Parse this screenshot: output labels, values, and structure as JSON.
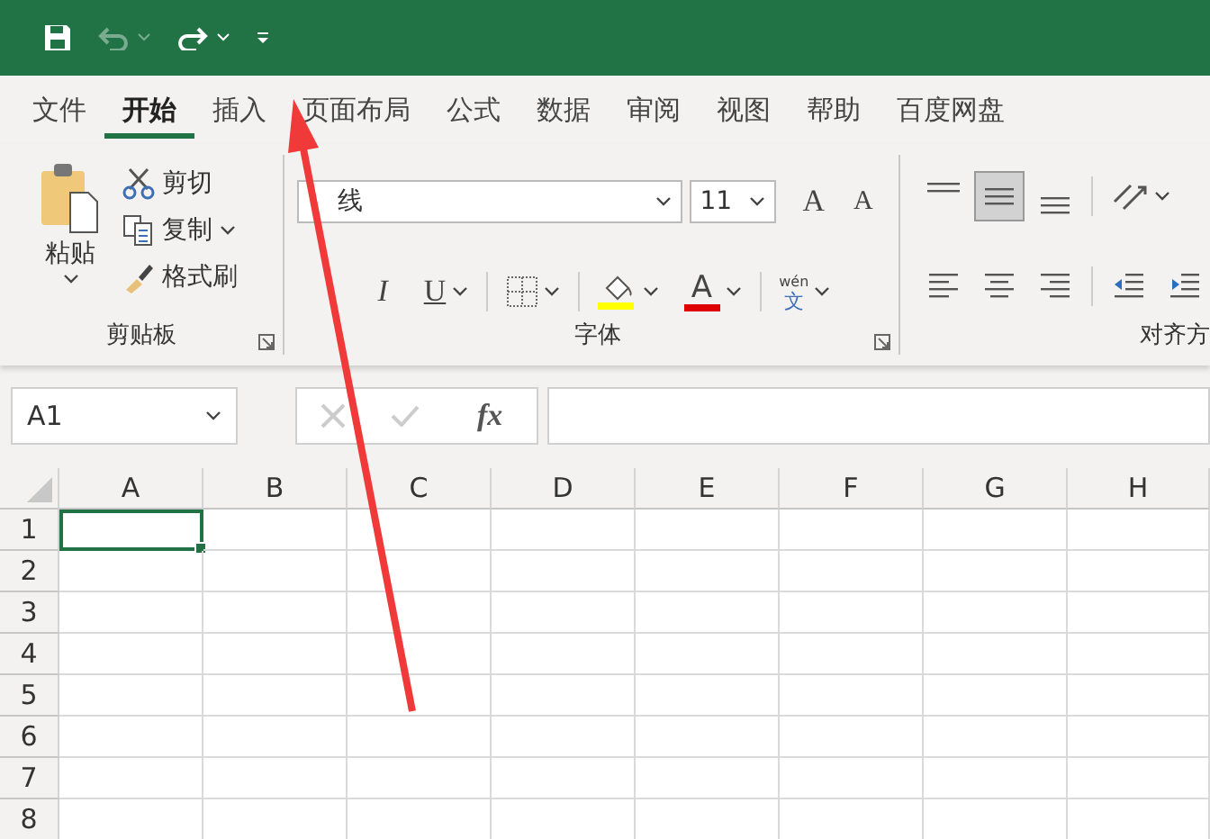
{
  "quick_access": {
    "undo_disabled": true
  },
  "tabs": [
    {
      "label": "文件",
      "selected": false
    },
    {
      "label": "开始",
      "selected": true
    },
    {
      "label": "插入",
      "selected": false
    },
    {
      "label": "页面布局",
      "selected": false
    },
    {
      "label": "公式",
      "selected": false
    },
    {
      "label": "数据",
      "selected": false
    },
    {
      "label": "审阅",
      "selected": false
    },
    {
      "label": "视图",
      "selected": false
    },
    {
      "label": "帮助",
      "selected": false
    },
    {
      "label": "百度网盘",
      "selected": false
    }
  ],
  "clipboard": {
    "paste": "粘贴",
    "cut": "剪切",
    "copy": "复制",
    "format_painter": "格式刷",
    "label": "剪贴板"
  },
  "font": {
    "font_name": "线",
    "font_size": "11",
    "grow": "A",
    "shrink": "A",
    "italic": "I",
    "underline": "U",
    "font_color": "A",
    "phonetic_top": "wén",
    "phonetic_bottom": "文",
    "label": "字体"
  },
  "alignment": {
    "top_row": [
      {
        "kind": "top",
        "selected": false
      },
      {
        "kind": "middle",
        "selected": true
      },
      {
        "kind": "bottom",
        "selected": false
      }
    ],
    "label": "对齐方"
  },
  "formula_bar": {
    "name_box": "A1",
    "fx": "fx"
  },
  "sheet": {
    "columns": [
      "A",
      "B",
      "C",
      "D",
      "E",
      "F",
      "G",
      "H"
    ],
    "rows": [
      {
        "label": "1",
        "cells": [
          {
            "selected": true
          },
          {
            "selected": false
          },
          {
            "selected": false
          },
          {
            "selected": false
          },
          {
            "selected": false
          },
          {
            "selected": false
          },
          {
            "selected": false
          },
          {
            "selected": false
          }
        ]
      },
      {
        "label": "2",
        "cells": [
          {
            "selected": false
          },
          {
            "selected": false
          },
          {
            "selected": false
          },
          {
            "selected": false
          },
          {
            "selected": false
          },
          {
            "selected": false
          },
          {
            "selected": false
          },
          {
            "selected": false
          }
        ]
      },
      {
        "label": "3",
        "cells": [
          {
            "selected": false
          },
          {
            "selected": false
          },
          {
            "selected": false
          },
          {
            "selected": false
          },
          {
            "selected": false
          },
          {
            "selected": false
          },
          {
            "selected": false
          },
          {
            "selected": false
          }
        ]
      },
      {
        "label": "4",
        "cells": [
          {
            "selected": false
          },
          {
            "selected": false
          },
          {
            "selected": false
          },
          {
            "selected": false
          },
          {
            "selected": false
          },
          {
            "selected": false
          },
          {
            "selected": false
          },
          {
            "selected": false
          }
        ]
      },
      {
        "label": "5",
        "cells": [
          {
            "selected": false
          },
          {
            "selected": false
          },
          {
            "selected": false
          },
          {
            "selected": false
          },
          {
            "selected": false
          },
          {
            "selected": false
          },
          {
            "selected": false
          },
          {
            "selected": false
          }
        ]
      },
      {
        "label": "6",
        "cells": [
          {
            "selected": false
          },
          {
            "selected": false
          },
          {
            "selected": false
          },
          {
            "selected": false
          },
          {
            "selected": false
          },
          {
            "selected": false
          },
          {
            "selected": false
          },
          {
            "selected": false
          }
        ]
      },
      {
        "label": "7",
        "cells": [
          {
            "selected": false
          },
          {
            "selected": false
          },
          {
            "selected": false
          },
          {
            "selected": false
          },
          {
            "selected": false
          },
          {
            "selected": false
          },
          {
            "selected": false
          },
          {
            "selected": false
          }
        ]
      },
      {
        "label": "8",
        "cells": [
          {
            "selected": false
          },
          {
            "selected": false
          },
          {
            "selected": false
          },
          {
            "selected": false
          },
          {
            "selected": false
          },
          {
            "selected": false
          },
          {
            "selected": false
          },
          {
            "selected": false
          }
        ]
      }
    ]
  }
}
